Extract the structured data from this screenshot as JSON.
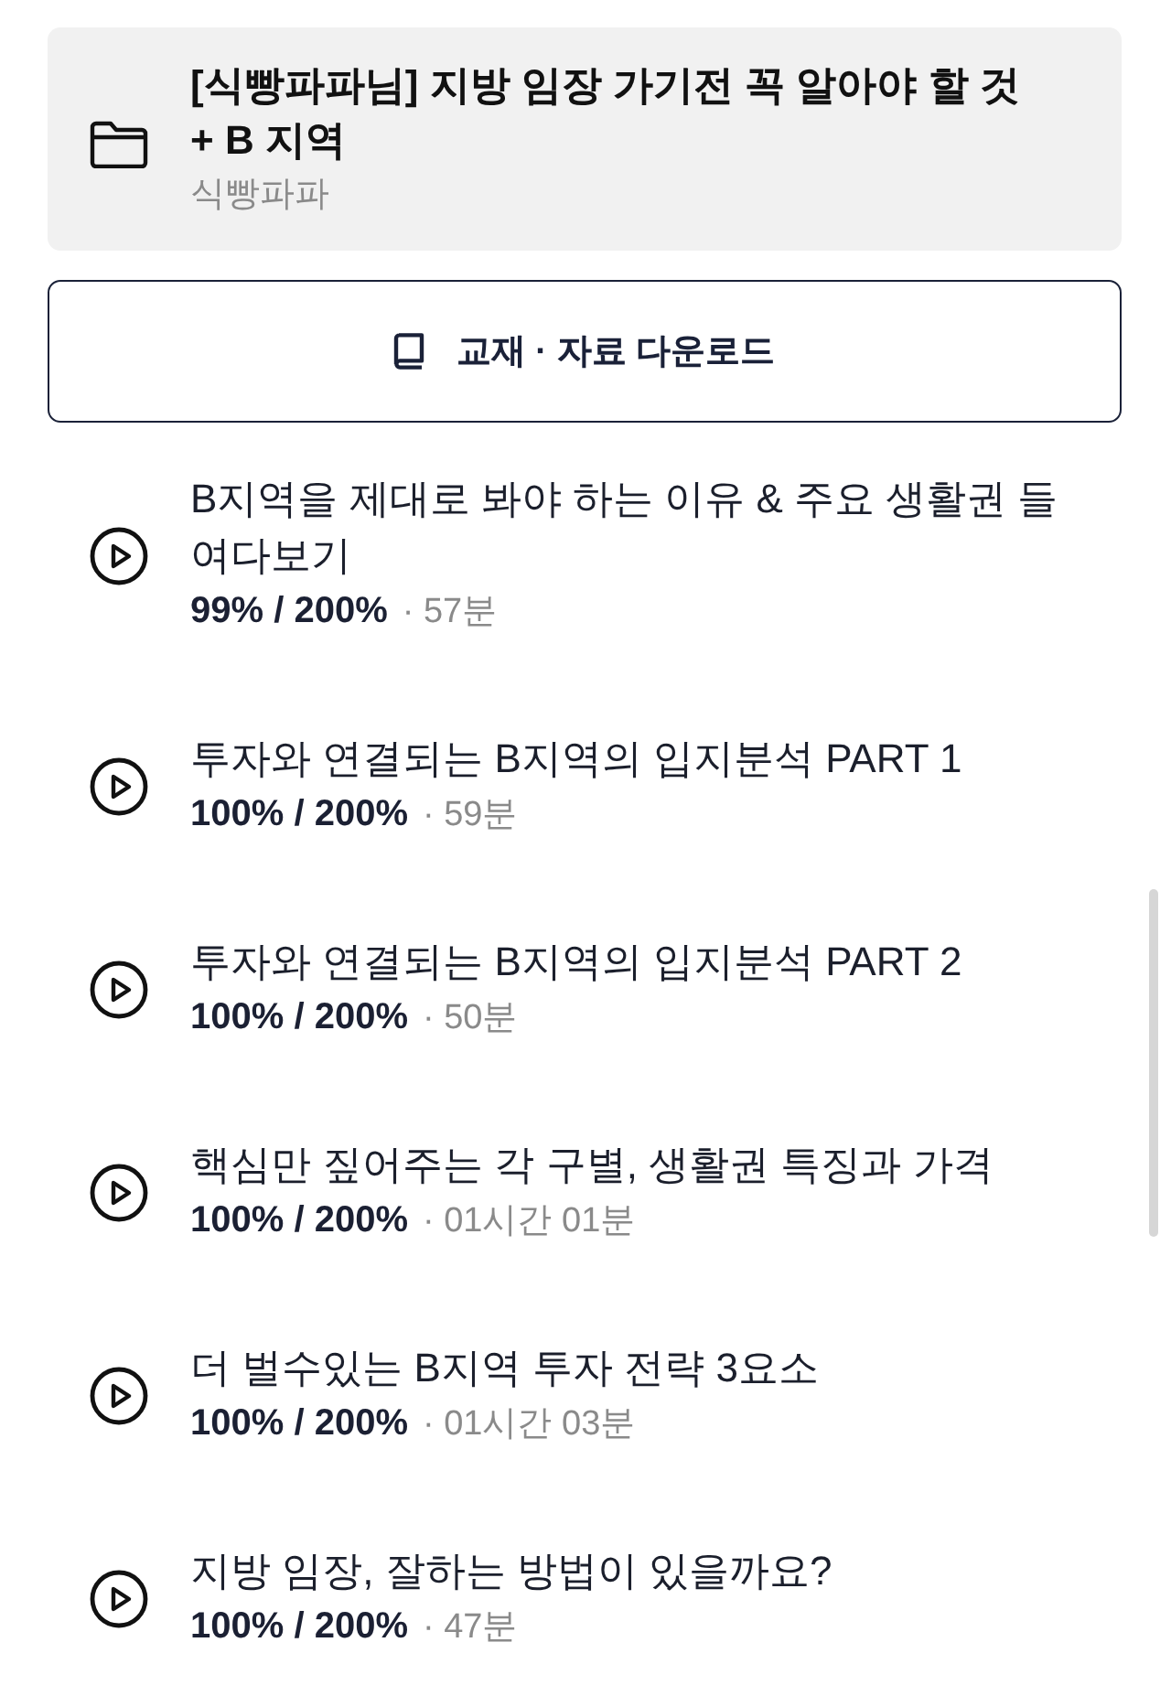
{
  "header": {
    "title": "[식빵파파님] 지방 임장 가기전 꼭 알아야 할 것 + B 지역",
    "author": "식빵파파"
  },
  "download_button": {
    "label": "교재 · 자료 다운로드"
  },
  "lessons": [
    {
      "title": "B지역을 제대로 봐야 하는 이유 & 주요 생활권 들여다보기",
      "stats": "99% / 200%",
      "duration": "· 57분"
    },
    {
      "title": "투자와 연결되는 B지역의 입지분석 PART 1",
      "stats": "100% / 200%",
      "duration": "· 59분"
    },
    {
      "title": "투자와 연결되는 B지역의 입지분석 PART 2",
      "stats": "100% / 200%",
      "duration": "· 50분"
    },
    {
      "title": "핵심만 짚어주는 각 구별, 생활권 특징과 가격",
      "stats": "100% / 200%",
      "duration": "· 01시간 01분"
    },
    {
      "title": "더 벌수있는 B지역 투자 전략 3요소",
      "stats": "100% / 200%",
      "duration": "· 01시간 03분"
    },
    {
      "title": "지방 임장, 잘하는 방법이 있을까요?",
      "stats": "100% / 200%",
      "duration": "· 47분"
    }
  ]
}
